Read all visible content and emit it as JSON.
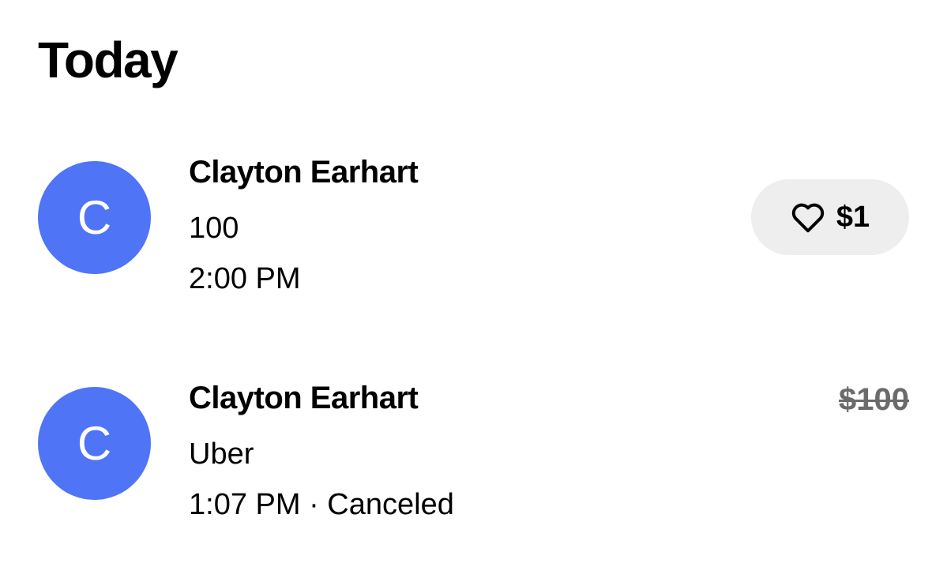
{
  "section": {
    "title": "Today"
  },
  "transactions": [
    {
      "avatar_letter": "C",
      "avatar_color": "#4f74f6",
      "name": "Clayton Earhart",
      "description": "100",
      "time": "2:00 PM",
      "tip_button": {
        "icon": "heart-icon",
        "label": "$1"
      }
    },
    {
      "avatar_letter": "C",
      "avatar_color": "#4f74f6",
      "name": "Clayton Earhart",
      "description": "Uber",
      "time_status": "1:07 PM · Canceled",
      "amount": "$100",
      "amount_struck_through": true
    }
  ]
}
